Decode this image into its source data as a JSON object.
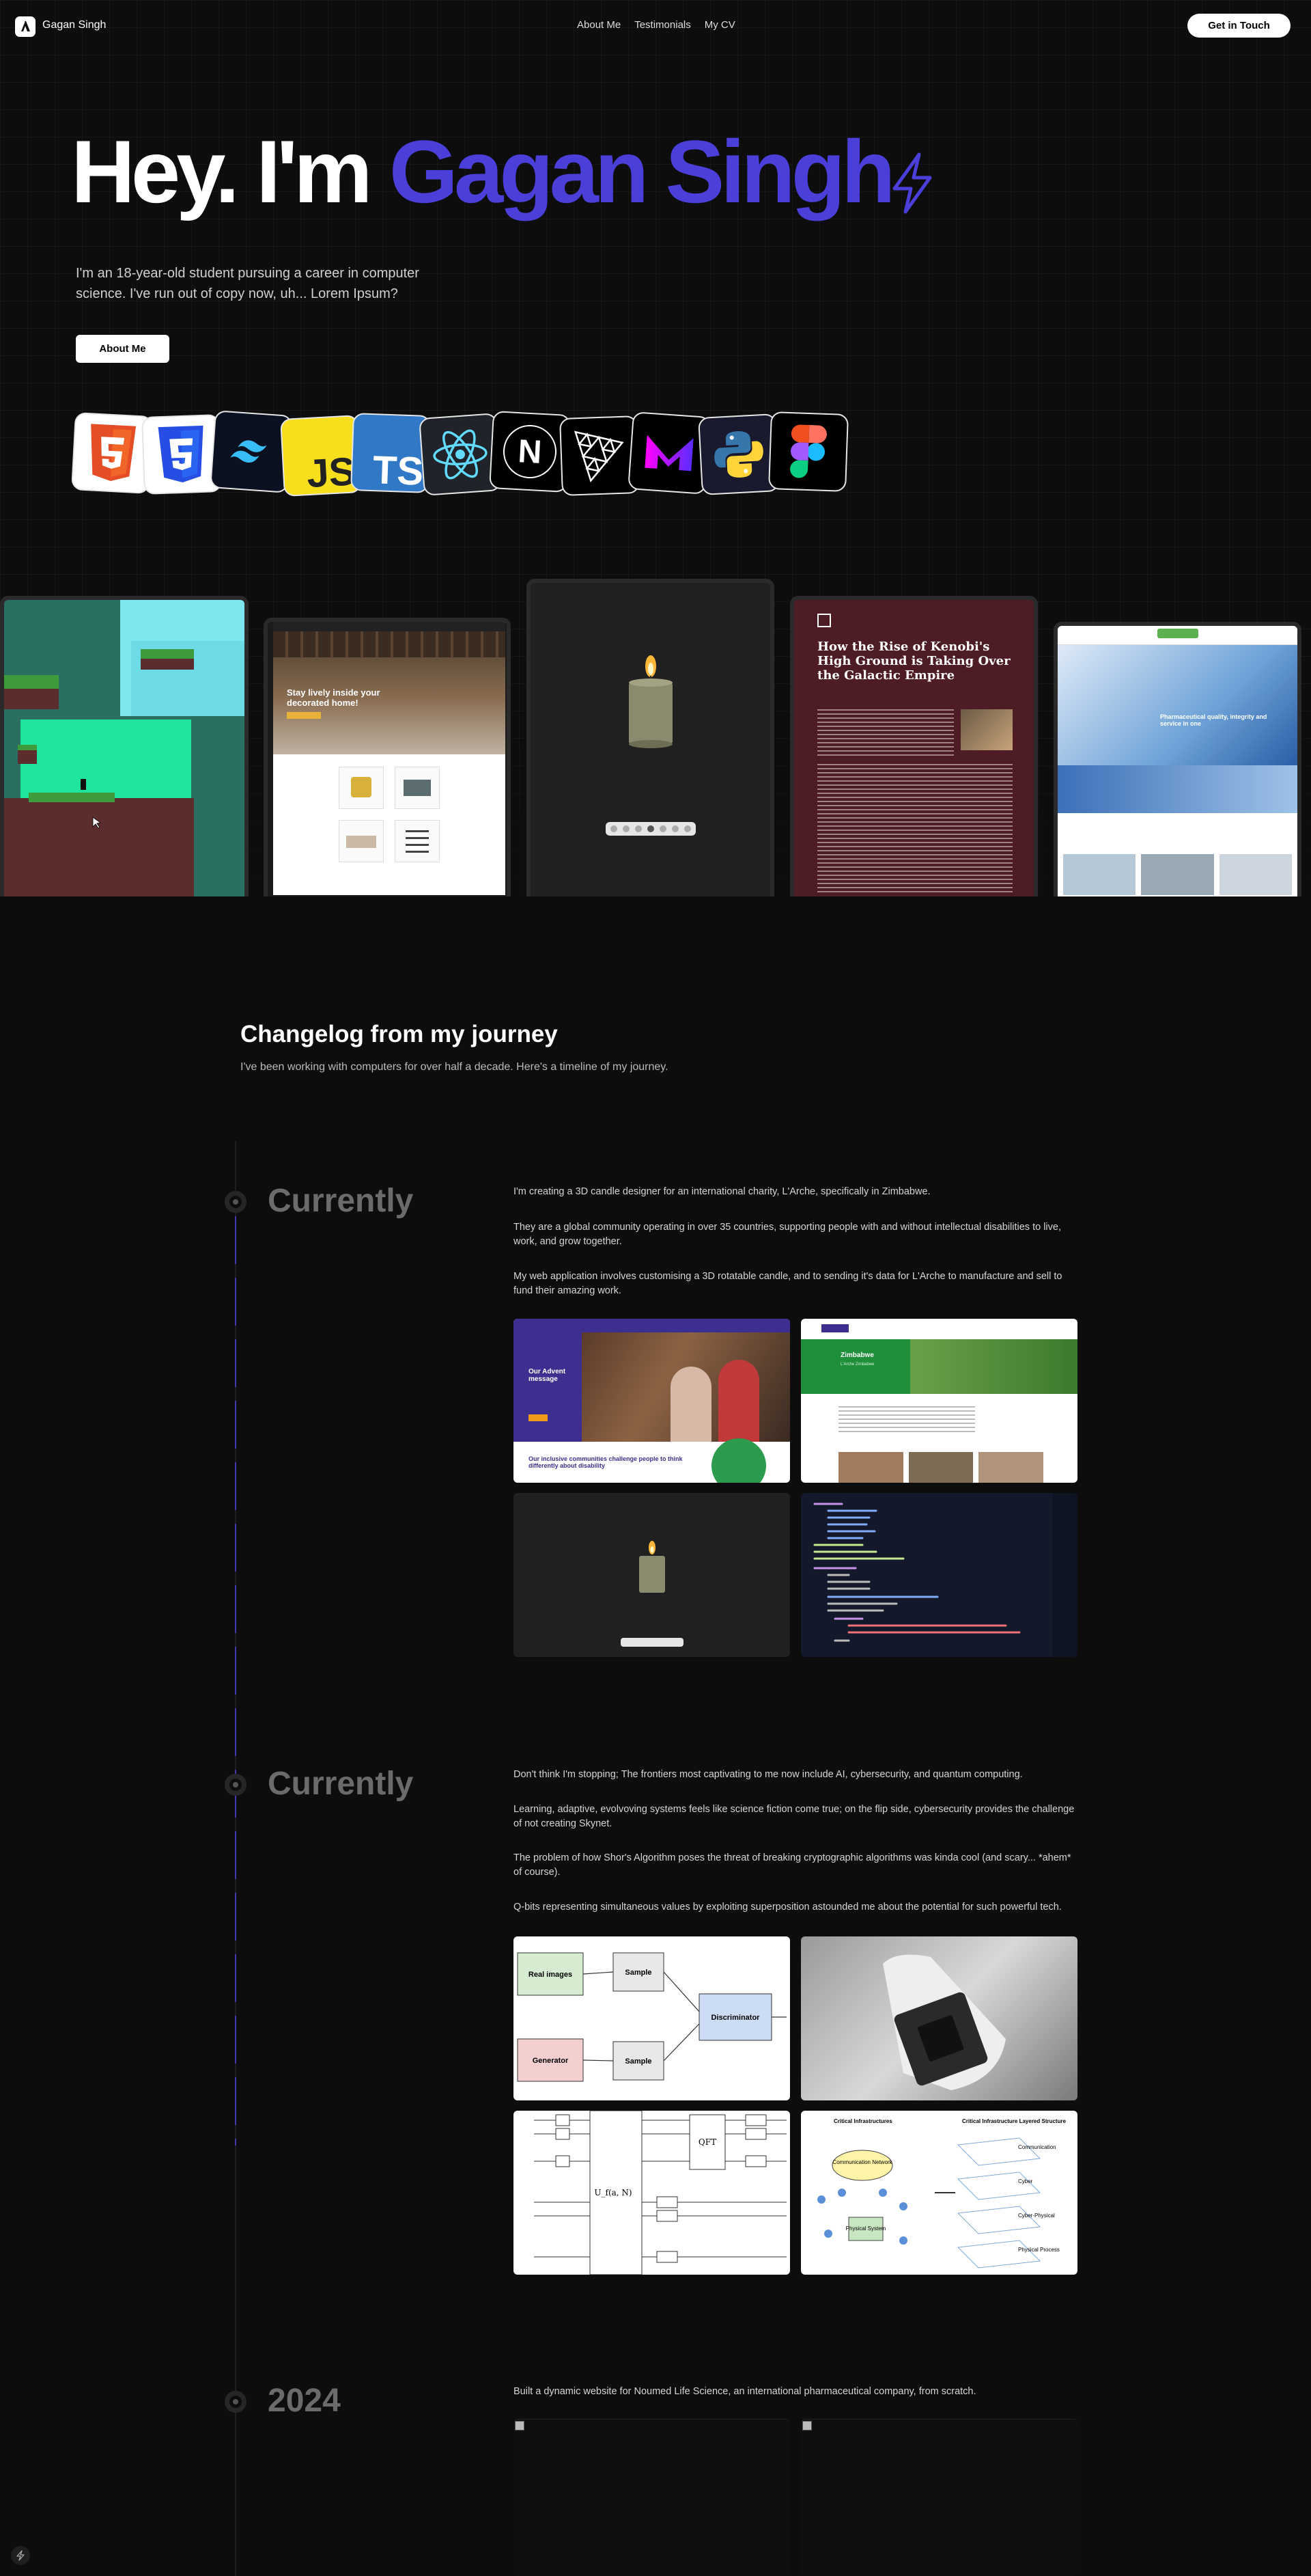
{
  "nav": {
    "brand": "Gagan Singh",
    "links": [
      "About Me",
      "Testimonials",
      "My CV"
    ],
    "cta": "Get in Touch"
  },
  "hero": {
    "title_prefix": "Hey. I'm",
    "title_name": "Gagan Singh",
    "subtitle": "I'm an 18-year-old student pursuing a career in computer science. I've run out of copy now, uh... Lorem Ipsum?",
    "button": "About Me"
  },
  "tech_icons": [
    "html5-icon",
    "css3-icon",
    "tailwind-icon",
    "javascript-icon",
    "typescript-icon",
    "react-icon",
    "nextjs-icon",
    "threejs-icon",
    "framer-motion-icon",
    "python-icon",
    "figma-icon"
  ],
  "tech_labels": {
    "js": "JS",
    "ts": "TS",
    "next": "N"
  },
  "showcase": {
    "furniture_text": "Stay lively inside your decorated home!",
    "article_title": "How the Rise of Kenobi's High Ground is Taking Over the Galactic Empire",
    "lab_caption": "Pharmaceutical quality, integrity and service in one"
  },
  "changelog": {
    "title": "Changelog from my journey",
    "subtitle": "I've been working with computers for over half a decade. Here's a timeline of my journey.",
    "entries": [
      {
        "label": "Currently",
        "paragraphs": [
          "I'm creating a 3D candle designer for an international charity, L'Arche, specifically in Zimbabwe.",
          "They are a global community operating in over 35 countries, supporting people with and without intellectual disabilities to live, work, and grow together.",
          "My web application involves customising a 3D rotatable candle, and to sending it's data for L'Arche to manufacture and sell to fund their amazing work."
        ],
        "shot_text": {
          "advent_title": "Our Advent message",
          "community": "Our inclusive communities challenge people to think differently about disability",
          "zimbabwe": "Zimbabwe",
          "zimbabwe_sub": "L'Arche Zimbabwe"
        }
      },
      {
        "label": "Currently",
        "paragraphs": [
          "Don't think I'm stopping; The frontiers most captivating to me now include AI, cybersecurity, and quantum computing.",
          "Learning, adaptive, evolvoving systems feels like science fiction come true; on the flip side, cybersecurity provides the challenge of not creating Skynet.",
          "The problem of how Shor's Algorithm poses the threat of breaking cryptographic algorithms was kinda cool (and scary... *ahem* of course).",
          "Q-bits representing simultaneous values by exploiting superposition astounded me about the potential for such powerful tech."
        ],
        "gan": {
          "real": "Real images",
          "sample": "Sample",
          "generator": "Generator",
          "discriminator": "Discriminator"
        },
        "quantum": {
          "qft": "QFT",
          "uf": "U_f(a, N)"
        },
        "infra": {
          "left_title": "Critical Infrastructures",
          "right_title": "Critical Infrastructure Layered Structure",
          "comm": "Communication Network",
          "phys": "Physical System",
          "layers": [
            "Communication",
            "Cyber",
            "Cyber-Physical",
            "Physical Process"
          ]
        }
      },
      {
        "label": "2024",
        "paragraphs": [
          "Built a dynamic website for Noumed Life Science, an international pharmaceutical company, from scratch."
        ]
      }
    ]
  },
  "colors": {
    "accent": "#4a3fd9",
    "background": "#0d0d0d",
    "timeline": "#4b3fd1"
  }
}
